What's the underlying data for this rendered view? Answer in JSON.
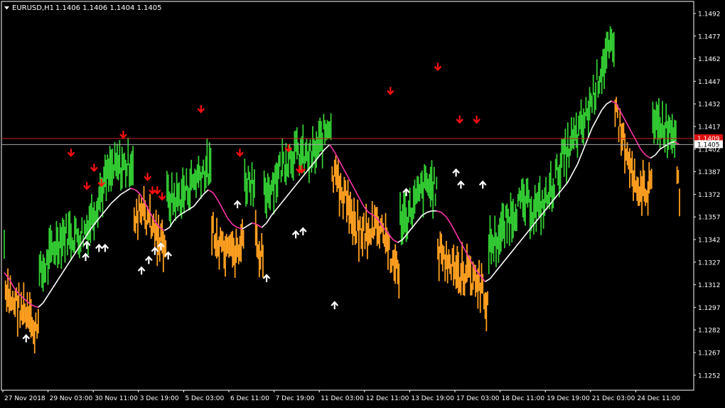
{
  "header": {
    "symbol_label": "EURUSD,H1",
    "ohlc_text": "1.1406 1.1406 1.1404 1.1405"
  },
  "colors": {
    "background": "#000000",
    "frame": "#ffffff",
    "bull_candles": "#33cc33",
    "bear_candles": "#ffa020",
    "fast_line_up": "#ffffff",
    "fast_line_down": "#ff33aa",
    "sell_arrow": "#ff1010",
    "buy_arrow": "#ffffff",
    "bid_line": "#cc2222",
    "price_line": "#aaaaaa",
    "tag_bg": "#ffffff",
    "tag_text": "#000000",
    "red_tag_bg": "#dd1111"
  },
  "chart_data": {
    "type": "line",
    "symbol": "EURUSD",
    "timeframe": "H1",
    "current_price": 1.1405,
    "current_price_label": "1.1405",
    "bid_line_price": 1.1409,
    "bid_tag_label": "1.1409",
    "ylim": [
      1.1242,
      1.15
    ],
    "y_ticks": [
      "1.1492",
      "1.1477",
      "1.1462",
      "1.1447",
      "1.1432",
      "1.1417",
      "1.1402",
      "1.1387",
      "1.1372",
      "1.1357",
      "1.1342",
      "1.1327",
      "1.1312",
      "1.1297",
      "1.1282",
      "1.1267",
      "1.1252"
    ],
    "x_labels": [
      "27 Nov 2018",
      "29 Nov 03:00",
      "30 Nov 11:00",
      "3 Dec 19:00",
      "5 Dec 03:00",
      "6 Dec 11:00",
      "7 Dec 19:00",
      "11 Dec 03:00",
      "12 Dec 11:00",
      "13 Dec 19:00",
      "17 Dec 03:00",
      "18 Dec 11:00",
      "19 Dec 19:00",
      "21 Dec 03:00",
      "24 Dec 11:00"
    ],
    "series": [
      {
        "values": [
          [
            0,
            1.132
          ],
          [
            4,
            1.1316
          ],
          [
            8,
            1.131
          ],
          [
            12,
            1.1306
          ],
          [
            16,
            1.1303
          ],
          [
            20,
            1.13
          ],
          [
            24,
            1.1298
          ],
          [
            28,
            1.1297
          ],
          [
            32,
            1.13
          ],
          [
            36,
            1.1305
          ],
          [
            40,
            1.131
          ],
          [
            44,
            1.1315
          ],
          [
            48,
            1.132
          ],
          [
            52,
            1.1325
          ],
          [
            56,
            1.133
          ],
          [
            60,
            1.1335
          ],
          [
            64,
            1.134
          ],
          [
            68,
            1.1345
          ],
          [
            72,
            1.135
          ],
          [
            76,
            1.1354
          ],
          [
            80,
            1.1358
          ],
          [
            84,
            1.1362
          ],
          [
            88,
            1.1366
          ],
          [
            92,
            1.1369
          ],
          [
            96,
            1.1372
          ],
          [
            100,
            1.1374
          ],
          [
            104,
            1.1376
          ],
          [
            108,
            1.1375
          ],
          [
            112,
            1.1372
          ],
          [
            116,
            1.1366
          ],
          [
            120,
            1.136
          ],
          [
            124,
            1.1354
          ],
          [
            128,
            1.135
          ],
          [
            132,
            1.1348
          ],
          [
            136,
            1.135
          ],
          [
            140,
            1.1355
          ],
          [
            144,
            1.1358
          ],
          [
            148,
            1.136
          ],
          [
            152,
            1.1362
          ],
          [
            156,
            1.1364
          ],
          [
            160,
            1.1368
          ],
          [
            164,
            1.1372
          ],
          [
            168,
            1.1375
          ],
          [
            172,
            1.1373
          ],
          [
            176,
            1.1368
          ],
          [
            180,
            1.1362
          ],
          [
            184,
            1.1356
          ],
          [
            188,
            1.1352
          ],
          [
            192,
            1.135
          ],
          [
            196,
            1.1349
          ],
          [
            200,
            1.1351
          ],
          [
            204,
            1.1353
          ],
          [
            208,
            1.1352
          ],
          [
            212,
            1.135
          ],
          [
            216,
            1.1353
          ],
          [
            220,
            1.1358
          ],
          [
            224,
            1.1362
          ],
          [
            228,
            1.1366
          ],
          [
            232,
            1.137
          ],
          [
            236,
            1.1374
          ],
          [
            240,
            1.1378
          ],
          [
            244,
            1.1382
          ],
          [
            248,
            1.1386
          ],
          [
            252,
            1.139
          ],
          [
            256,
            1.1394
          ],
          [
            260,
            1.1398
          ],
          [
            264,
            1.1402
          ],
          [
            268,
            1.1405
          ],
          [
            272,
            1.14
          ],
          [
            276,
            1.1394
          ],
          [
            280,
            1.1388
          ],
          [
            284,
            1.1382
          ],
          [
            288,
            1.1376
          ],
          [
            292,
            1.137
          ],
          [
            296,
            1.1364
          ],
          [
            300,
            1.136
          ],
          [
            304,
            1.1358
          ],
          [
            308,
            1.1355
          ],
          [
            312,
            1.135
          ],
          [
            316,
            1.1346
          ],
          [
            320,
            1.1342
          ],
          [
            324,
            1.134
          ],
          [
            328,
            1.1342
          ],
          [
            332,
            1.1346
          ],
          [
            336,
            1.135
          ],
          [
            340,
            1.1354
          ],
          [
            344,
            1.1358
          ],
          [
            348,
            1.136
          ],
          [
            352,
            1.1361
          ],
          [
            356,
            1.1361
          ],
          [
            360,
            1.136
          ],
          [
            364,
            1.1357
          ],
          [
            368,
            1.1352
          ],
          [
            372,
            1.1346
          ],
          [
            376,
            1.134
          ],
          [
            380,
            1.1334
          ],
          [
            384,
            1.1328
          ],
          [
            388,
            1.1322
          ],
          [
            392,
            1.1318
          ],
          [
            396,
            1.1314
          ],
          [
            400,
            1.1316
          ],
          [
            404,
            1.132
          ],
          [
            408,
            1.1324
          ],
          [
            412,
            1.1328
          ],
          [
            416,
            1.1332
          ],
          [
            420,
            1.1336
          ],
          [
            424,
            1.134
          ],
          [
            428,
            1.1344
          ],
          [
            432,
            1.1348
          ],
          [
            436,
            1.1352
          ],
          [
            440,
            1.1356
          ],
          [
            444,
            1.136
          ],
          [
            448,
            1.1364
          ],
          [
            452,
            1.1368
          ],
          [
            456,
            1.1372
          ],
          [
            460,
            1.1376
          ],
          [
            464,
            1.138
          ],
          [
            468,
            1.1386
          ],
          [
            472,
            1.1392
          ],
          [
            476,
            1.14
          ],
          [
            480,
            1.1408
          ],
          [
            484,
            1.1416
          ],
          [
            488,
            1.1422
          ],
          [
            492,
            1.1428
          ],
          [
            496,
            1.1432
          ],
          [
            500,
            1.1434
          ],
          [
            504,
            1.1432
          ],
          [
            508,
            1.1426
          ],
          [
            512,
            1.142
          ],
          [
            516,
            1.1414
          ],
          [
            520,
            1.1408
          ],
          [
            524,
            1.1402
          ],
          [
            528,
            1.1398
          ],
          [
            532,
            1.1396
          ],
          [
            536,
            1.1398
          ],
          [
            540,
            1.1402
          ],
          [
            544,
            1.1404
          ],
          [
            548,
            1.1406
          ],
          [
            552,
            1.1407
          ],
          [
            556,
            1.1405
          ]
        ]
      }
    ],
    "sell_arrows": [
      [
        55,
        1.1398
      ],
      [
        68,
        1.1376
      ],
      [
        74,
        1.1388
      ],
      [
        80,
        1.1378
      ],
      [
        98,
        1.141
      ],
      [
        118,
        1.1382
      ],
      [
        122,
        1.1373
      ],
      [
        126,
        1.1373
      ],
      [
        130,
        1.1369
      ],
      [
        162,
        1.1427
      ],
      [
        194,
        1.1398
      ],
      [
        234,
        1.1401
      ],
      [
        243,
        1.1387
      ],
      [
        245,
        1.1387
      ],
      [
        318,
        1.1439
      ],
      [
        357,
        1.1455
      ],
      [
        375,
        1.142
      ],
      [
        389,
        1.142
      ]
    ],
    "buy_arrows": [
      [
        18,
        1.1278
      ],
      [
        67,
        1.1332
      ],
      [
        68,
        1.134
      ],
      [
        78,
        1.1338
      ],
      [
        83,
        1.1338
      ],
      [
        113,
        1.1323
      ],
      [
        119,
        1.133
      ],
      [
        124,
        1.1336
      ],
      [
        129,
        1.1339
      ],
      [
        135,
        1.1333
      ],
      [
        192,
        1.1367
      ],
      [
        216,
        1.1318
      ],
      [
        240,
        1.1347
      ],
      [
        246,
        1.1349
      ],
      [
        272,
        1.13
      ],
      [
        331,
        1.1375
      ],
      [
        372,
        1.1388
      ],
      [
        376,
        1.138
      ],
      [
        394,
        1.138
      ]
    ]
  }
}
